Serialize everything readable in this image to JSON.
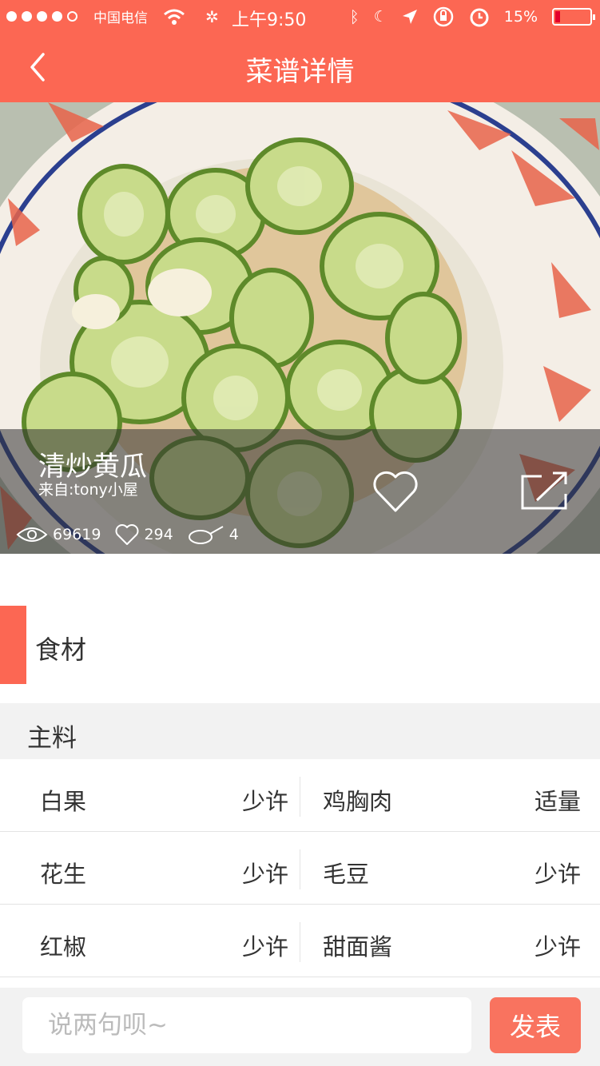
{
  "status_bar": {
    "signal_dots": 5,
    "signal_filled": 4,
    "carrier": "中国电信",
    "time": "上午9:50",
    "battery": "15%",
    "battery_level": 0.15
  },
  "nav": {
    "title": "菜谱详情",
    "back_icon": "chevron-left-icon"
  },
  "hero": {
    "dish_name": "清炒黄瓜",
    "source": "来自:tony小屋",
    "views": "69619",
    "likes": "294",
    "cooked": "4",
    "favorite_icon": "heart-outline-icon",
    "share_icon": "share-icon"
  },
  "ingredients": {
    "section_title": "食材",
    "group_title": "主料",
    "rows": [
      {
        "left": {
          "name": "白果",
          "qty": "少许"
        },
        "right": {
          "name": "鸡胸肉",
          "qty": "适量"
        }
      },
      {
        "left": {
          "name": "花生",
          "qty": "少许"
        },
        "right": {
          "name": "毛豆",
          "qty": "少许"
        }
      },
      {
        "left": {
          "name": "红椒",
          "qty": "少许"
        },
        "right": {
          "name": "甜面酱",
          "qty": "少许"
        }
      }
    ]
  },
  "comment": {
    "placeholder": "说两句呗~",
    "submit_label": "发表"
  },
  "colors": {
    "accent": "#fc6753",
    "button": "#f9735f",
    "subhead_bg": "#f2f2f2"
  }
}
